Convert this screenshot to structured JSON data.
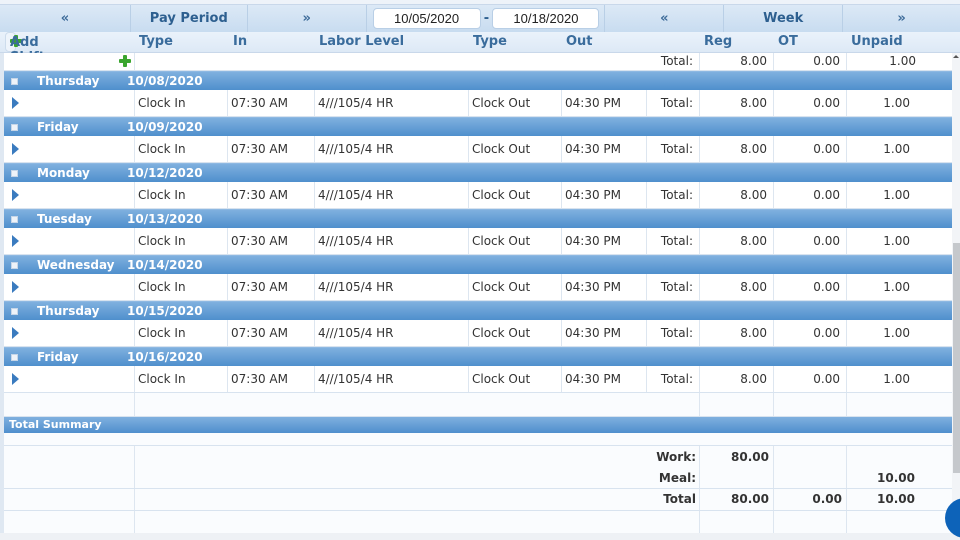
{
  "nav": {
    "pay_period_prev": "«",
    "pay_period_label": "Pay Period",
    "pay_period_next": "»",
    "start_date": "10/05/2020",
    "date_separator": "-",
    "end_date": "10/18/2020",
    "week_prev": "«",
    "week_label": "Week",
    "week_next": "»"
  },
  "columns": {
    "add_shift": "Add Shift",
    "type_in": "Type",
    "in": "In",
    "labor_level": "Labor Level",
    "type_out": "Type",
    "out": "Out",
    "reg": "Reg",
    "ot": "OT",
    "unpaid": "Unpaid"
  },
  "partial_row": {
    "total_label": "Total:",
    "reg": "8.00",
    "ot": "0.00",
    "unpaid": "1.00"
  },
  "days": [
    {
      "day": "Thursday",
      "date": "10/08/2020",
      "type_in": "Clock In",
      "in": "07:30 AM",
      "labor_level": "4///105/4 HR",
      "type_out": "Clock Out",
      "out": "04:30 PM",
      "total_label": "Total:",
      "reg": "8.00",
      "ot": "0.00",
      "unpaid": "1.00"
    },
    {
      "day": "Friday",
      "date": "10/09/2020",
      "type_in": "Clock In",
      "in": "07:30 AM",
      "labor_level": "4///105/4 HR",
      "type_out": "Clock Out",
      "out": "04:30 PM",
      "total_label": "Total:",
      "reg": "8.00",
      "ot": "0.00",
      "unpaid": "1.00"
    },
    {
      "day": "Monday",
      "date": "10/12/2020",
      "type_in": "Clock In",
      "in": "07:30 AM",
      "labor_level": "4///105/4 HR",
      "type_out": "Clock Out",
      "out": "04:30 PM",
      "total_label": "Total:",
      "reg": "8.00",
      "ot": "0.00",
      "unpaid": "1.00"
    },
    {
      "day": "Tuesday",
      "date": "10/13/2020",
      "type_in": "Clock In",
      "in": "07:30 AM",
      "labor_level": "4///105/4 HR",
      "type_out": "Clock Out",
      "out": "04:30 PM",
      "total_label": "Total:",
      "reg": "8.00",
      "ot": "0.00",
      "unpaid": "1.00"
    },
    {
      "day": "Wednesday",
      "date": "10/14/2020",
      "type_in": "Clock In",
      "in": "07:30 AM",
      "labor_level": "4///105/4 HR",
      "type_out": "Clock Out",
      "out": "04:30 PM",
      "total_label": "Total:",
      "reg": "8.00",
      "ot": "0.00",
      "unpaid": "1.00"
    },
    {
      "day": "Thursday",
      "date": "10/15/2020",
      "type_in": "Clock In",
      "in": "07:30 AM",
      "labor_level": "4///105/4 HR",
      "type_out": "Clock Out",
      "out": "04:30 PM",
      "total_label": "Total:",
      "reg": "8.00",
      "ot": "0.00",
      "unpaid": "1.00"
    },
    {
      "day": "Friday",
      "date": "10/16/2020",
      "type_in": "Clock In",
      "in": "07:30 AM",
      "labor_level": "4///105/4 HR",
      "type_out": "Clock Out",
      "out": "04:30 PM",
      "total_label": "Total:",
      "reg": "8.00",
      "ot": "0.00",
      "unpaid": "1.00"
    }
  ],
  "summary": {
    "title": "Total Summary",
    "work_label": "Work:",
    "work_reg": "80.00",
    "meal_label": "Meal:",
    "meal_unpaid": "10.00",
    "total_label": "Total",
    "total_reg": "80.00",
    "total_ot": "0.00",
    "total_unpaid": "10.00"
  }
}
